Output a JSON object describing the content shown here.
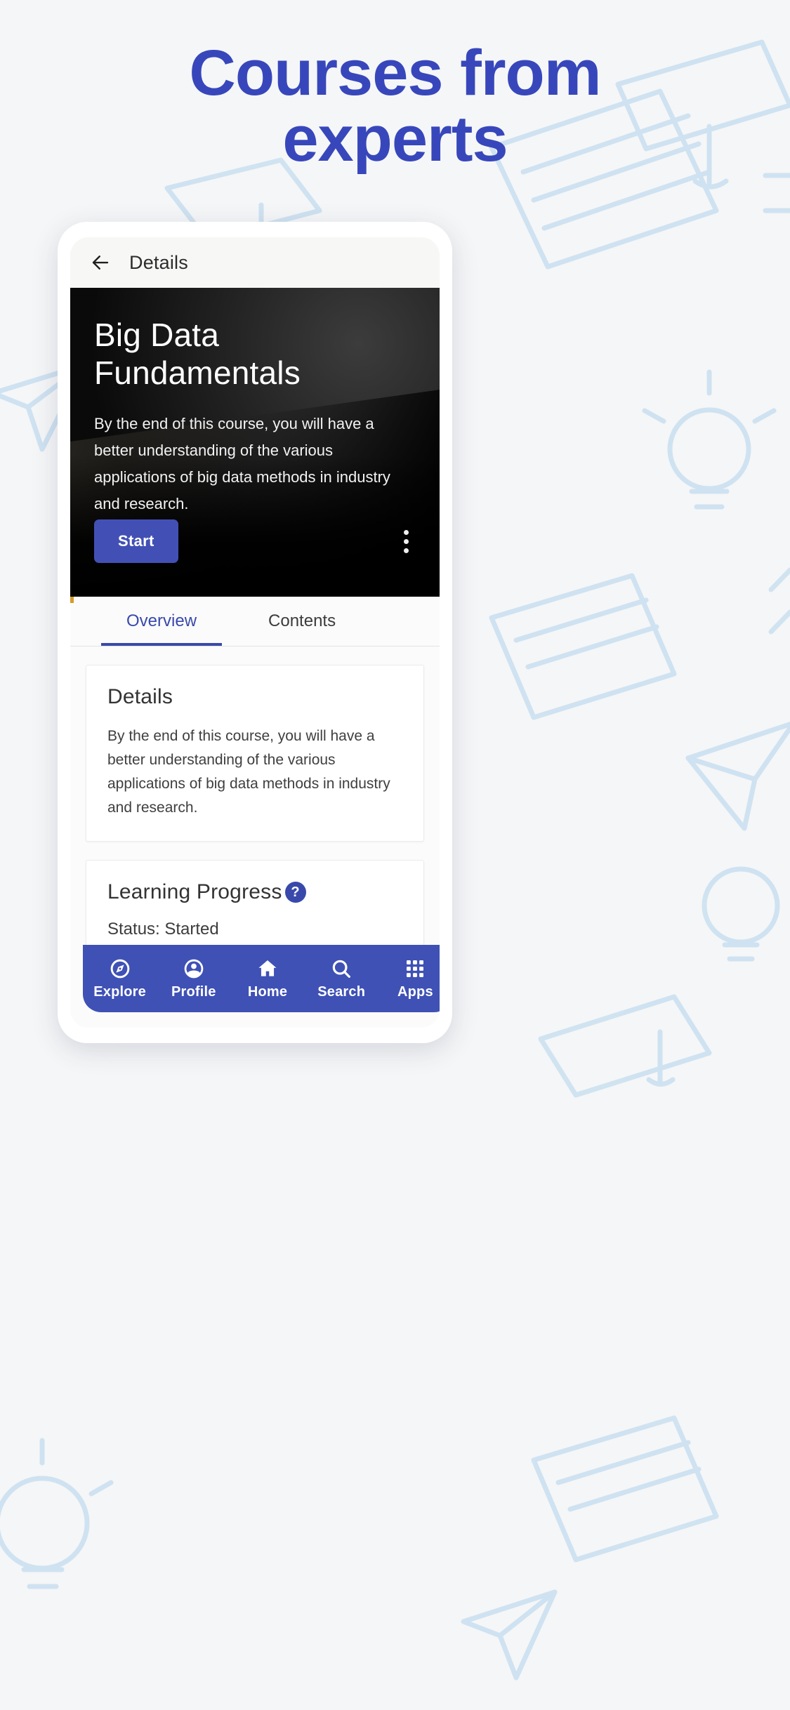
{
  "promo": {
    "line1": "Courses from",
    "line2": "experts",
    "color": "#3747bb"
  },
  "phone": {
    "appbar": {
      "back_icon": "arrow-left-icon",
      "title": "Details"
    },
    "hero": {
      "title": "Big Data Fundamentals",
      "description": "By the end of this course, you will have a better understanding of the various applications of big data methods in industry and research.",
      "start_label": "Start",
      "start_color": "#4250b5",
      "overflow_icon": "more-vertical-icon"
    },
    "tabs": [
      {
        "label": "Overview",
        "active": true
      },
      {
        "label": "Contents",
        "active": false
      }
    ],
    "cards": [
      {
        "heading": "Details",
        "body": "By the end of this course, you will have a better understanding of the various applications of big data methods in industry and research."
      },
      {
        "heading": "Learning Progress",
        "help_icon": "help-circle-icon",
        "help_glyph": "?",
        "status": "Status: Started"
      }
    ],
    "bottom_nav": {
      "background": "#3f51b5",
      "items": [
        {
          "label": "Explore",
          "icon": "compass-icon"
        },
        {
          "label": "Profile",
          "icon": "person-circle-icon"
        },
        {
          "label": "Home",
          "icon": "home-icon"
        },
        {
          "label": "Search",
          "icon": "search-icon"
        },
        {
          "label": "Apps",
          "icon": "apps-grid-icon"
        }
      ]
    }
  },
  "background": {
    "art_color": "#c6dcef",
    "page_color": "#f5f6f7"
  }
}
